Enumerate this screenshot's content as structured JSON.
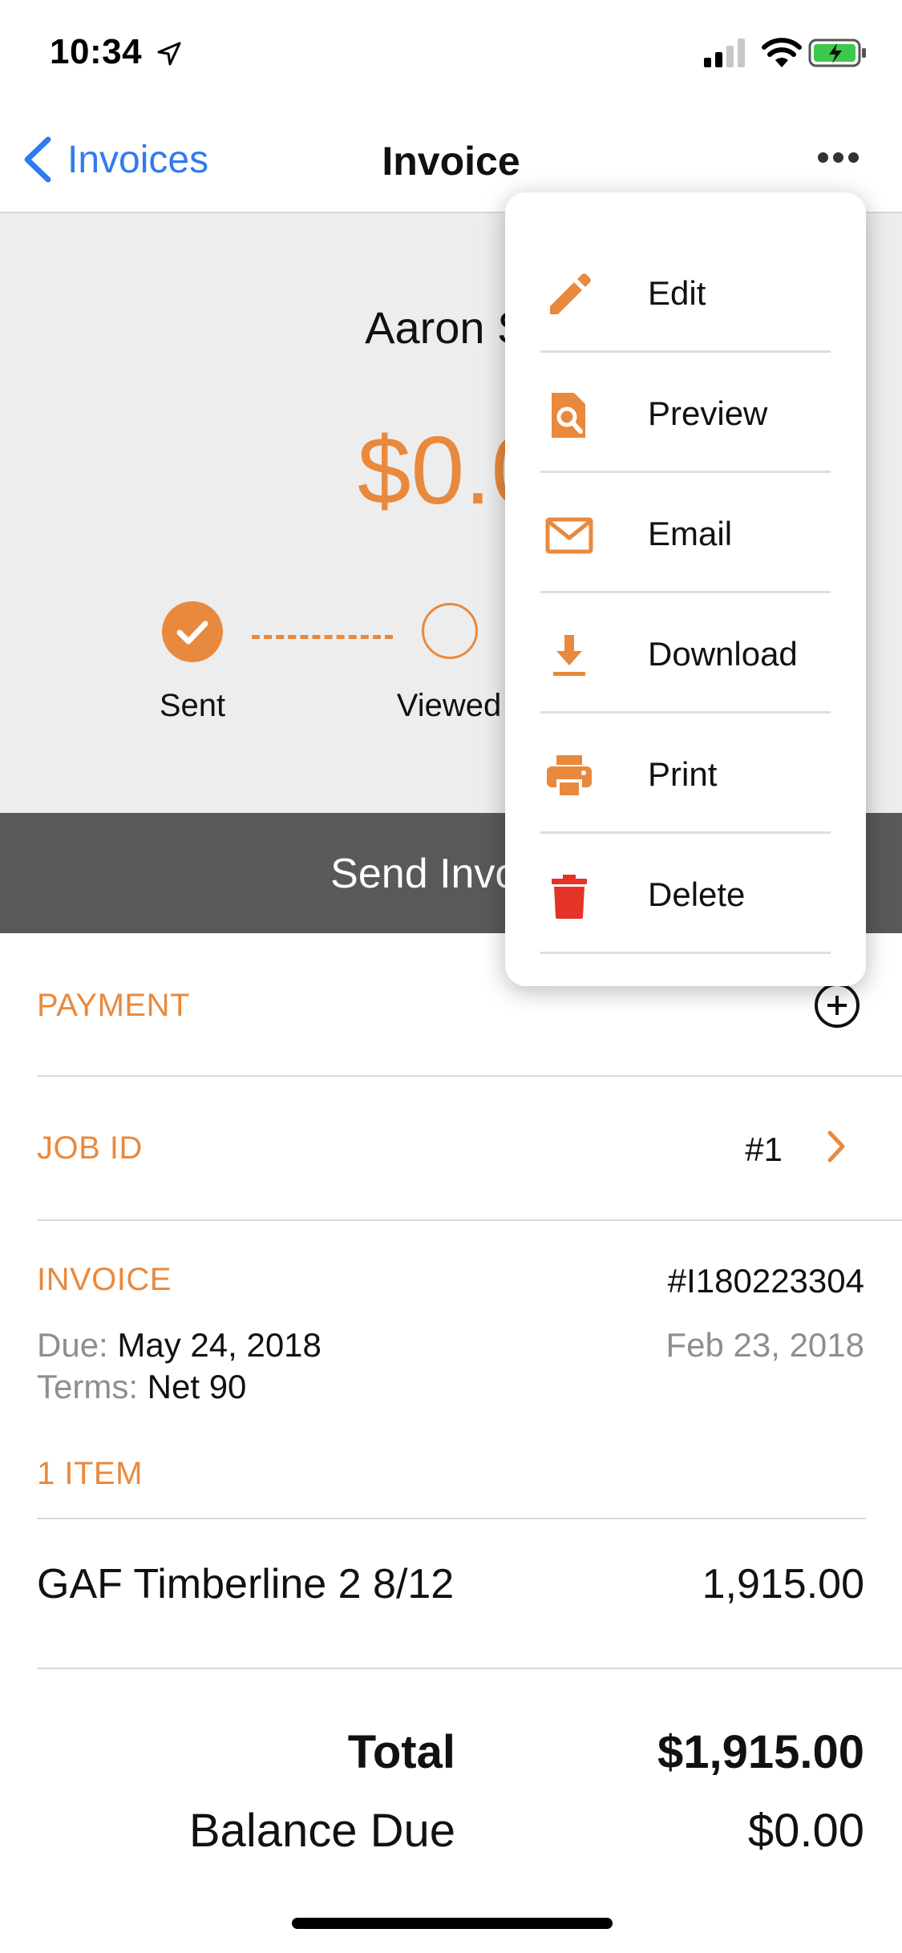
{
  "status_bar": {
    "time": "10:34"
  },
  "nav": {
    "back_label": "Invoices",
    "title": "Invoice"
  },
  "hero": {
    "customer_name": "Aaron Si",
    "amount": "$0.0",
    "steps": [
      {
        "label": "Sent",
        "state": "done"
      },
      {
        "label": "Viewed",
        "state": "pending"
      }
    ],
    "send_button": "Send Invoice"
  },
  "payment": {
    "label": "PAYMENT"
  },
  "job": {
    "label": "JOB ID",
    "value": "#1"
  },
  "invoice": {
    "label": "INVOICE",
    "number": "#I180223304",
    "due_label": "Due:",
    "due_value": "May 24, 2018",
    "terms_label": "Terms:",
    "terms_value": "Net 90",
    "date": "Feb 23, 2018"
  },
  "items": {
    "header": "1 ITEM",
    "rows": [
      {
        "name": "GAF Timberline 2 8/12",
        "amount": "1,915.00"
      }
    ]
  },
  "totals": {
    "total_label": "Total",
    "total_value": "$1,915.00",
    "balance_label": "Balance Due",
    "balance_value": "$0.00"
  },
  "menu": {
    "items": [
      {
        "label": "Edit",
        "icon": "pencil-icon"
      },
      {
        "label": "Preview",
        "icon": "document-search-icon"
      },
      {
        "label": "Email",
        "icon": "envelope-icon"
      },
      {
        "label": "Download",
        "icon": "download-icon"
      },
      {
        "label": "Print",
        "icon": "printer-icon"
      },
      {
        "label": "Delete",
        "icon": "trash-icon"
      }
    ]
  },
  "colors": {
    "accent": "#e9893d",
    "link": "#2f7bf0",
    "send_bar": "#595959",
    "delete": "#e53327"
  }
}
